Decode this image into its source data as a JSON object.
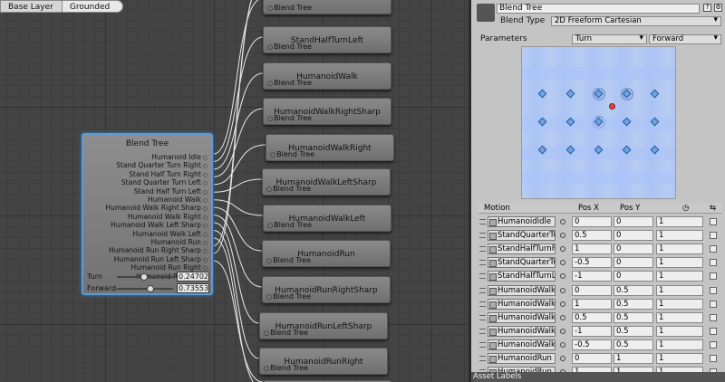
{
  "breadcrumb": [
    "Base Layer",
    "Grounded"
  ],
  "graph": {
    "blend_node": {
      "title": "Blend Tree",
      "inputs": [
        "Humanoid Idle",
        "Stand Quarter Turn Right",
        "Stand Half Turn Right",
        "Stand Quarter Turn Left",
        "Stand Half Turn Left",
        "Humanoid Walk",
        "Humanoid Walk Right Sharp",
        "Humanoid Walk Right",
        "Humanoid Walk Left Sharp",
        "Humanoid Walk Left",
        "Humanoid Run",
        "Humanoid Run Right Sharp",
        "Humanoid Run Left Sharp",
        "Humanoid Run Right",
        "Humanoid Run Left"
      ],
      "params": [
        {
          "label": "Turn",
          "value": "0.24702",
          "level": 0.5
        },
        {
          "label": "Forward",
          "value": "0.73553",
          "level": 0.62
        }
      ]
    },
    "child_port_label": "Blend Tree",
    "children": [
      "",
      "StandHalfTurnLeft",
      "HumanoidWalk",
      "HumanoidWalkRightSharp",
      "HumanoidWalkRight",
      "HumanoidWalkLeftSharp",
      "HumanoidWalkLeft",
      "HumanoidRun",
      "HumanoidRunRightSharp",
      "HumanoidRunLeftSharp",
      "HumanoidRunRight"
    ]
  },
  "inspector": {
    "name": "Blend Tree",
    "blend_type_label": "Blend Type",
    "blend_type": "2D Freeform Cartesian",
    "parameters_label": "Parameters",
    "param_x": "Turn",
    "param_y": "Forward",
    "table": {
      "headers": {
        "motion": "Motion",
        "pos_x": "Pos X",
        "pos_y": "Pos Y"
      },
      "rows": [
        {
          "clip": "HumanoidIdle",
          "x": "0",
          "y": "0",
          "speed": "1"
        },
        {
          "clip": "StandQuarterTu",
          "x": "0.5",
          "y": "0",
          "speed": "1"
        },
        {
          "clip": "StandHalfTurnR",
          "x": "1",
          "y": "0",
          "speed": "1"
        },
        {
          "clip": "StandQuarterTu",
          "x": "-0.5",
          "y": "0",
          "speed": "1"
        },
        {
          "clip": "StandHalfTurnL",
          "x": "-1",
          "y": "0",
          "speed": "1"
        },
        {
          "clip": "HumanoidWalk",
          "x": "0",
          "y": "0.5",
          "speed": "1"
        },
        {
          "clip": "HumanoidWalk",
          "x": "1",
          "y": "0.5",
          "speed": "1"
        },
        {
          "clip": "HumanoidWalk",
          "x": "0.5",
          "y": "0.5",
          "speed": "1"
        },
        {
          "clip": "HumanoidWalk",
          "x": "-1",
          "y": "0.5",
          "speed": "1"
        },
        {
          "clip": "HumanoidWalk",
          "x": "-0.5",
          "y": "0.5",
          "speed": "1"
        },
        {
          "clip": "HumanoidRun",
          "x": "0",
          "y": "1",
          "speed": "1"
        },
        {
          "clip": "HumanoidRun",
          "x": "1",
          "y": "1",
          "speed": "1"
        }
      ]
    },
    "asset_labels": "Asset Labels"
  },
  "colors": {
    "selection": "#5a9ad6",
    "plot": "#b8ccf2",
    "point": "#6ea4e0",
    "current": "#e04040"
  }
}
